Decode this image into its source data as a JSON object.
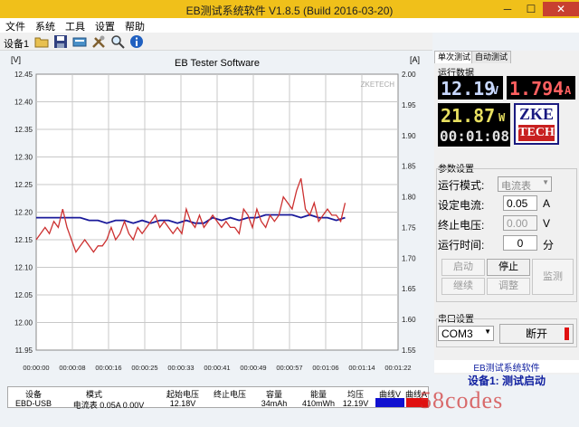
{
  "window": {
    "title": "EB测试系统软件 V1.8.5 (Build 2016-03-20)"
  },
  "menu": [
    "文件",
    "系统",
    "工具",
    "设置",
    "帮助"
  ],
  "toolbar": {
    "device_label": "设备1"
  },
  "chart_data": {
    "type": "line",
    "title": "EB Tester Software",
    "watermark": "ZKETECH",
    "y_left_label": "[V]",
    "y_right_label": "[A]",
    "ylim_left": [
      11.95,
      12.45
    ],
    "ylim_right": [
      1.55,
      2.0
    ],
    "yticks_left": [
      "12.45",
      "12.40",
      "12.35",
      "12.30",
      "12.25",
      "12.20",
      "12.15",
      "12.10",
      "12.05",
      "12.00",
      "11.95"
    ],
    "yticks_right": [
      "2.00",
      "1.95",
      "1.90",
      "1.85",
      "1.80",
      "1.75",
      "1.70",
      "1.65",
      "1.60",
      "1.55"
    ],
    "xticks": [
      "00:00:00",
      "00:00:08",
      "00:00:16",
      "00:00:25",
      "00:00:33",
      "00:00:41",
      "00:00:49",
      "00:00:57",
      "00:01:06",
      "00:01:14",
      "00:01:22"
    ],
    "series": [
      {
        "axis": "left",
        "color": "#1a1a9a",
        "x": [
          0,
          2,
          4,
          6,
          8,
          10,
          12,
          14,
          16,
          18,
          20,
          22,
          24,
          26,
          28,
          30,
          32,
          34,
          36,
          38,
          40,
          42,
          44,
          46,
          48,
          50,
          52,
          54,
          56,
          58,
          60,
          62,
          64,
          66,
          68,
          70
        ],
        "values": [
          12.19,
          12.19,
          12.19,
          12.19,
          12.19,
          12.19,
          12.185,
          12.185,
          12.18,
          12.185,
          12.185,
          12.18,
          12.185,
          12.18,
          12.185,
          12.185,
          12.18,
          12.185,
          12.18,
          12.18,
          12.19,
          12.185,
          12.19,
          12.185,
          12.19,
          12.19,
          12.195,
          12.195,
          12.195,
          12.195,
          12.19,
          12.195,
          12.19,
          12.19,
          12.185,
          12.19
        ]
      },
      {
        "axis": "right",
        "color": "#cc3030",
        "x": [
          0,
          1,
          2,
          3,
          4,
          5,
          6,
          7,
          8,
          9,
          10,
          11,
          12,
          13,
          14,
          15,
          16,
          17,
          18,
          19,
          20,
          21,
          22,
          23,
          24,
          25,
          26,
          27,
          28,
          29,
          30,
          31,
          32,
          33,
          34,
          35,
          36,
          37,
          38,
          39,
          40,
          41,
          42,
          43,
          44,
          45,
          46,
          47,
          48,
          49,
          50,
          51,
          52,
          53,
          54,
          55,
          56,
          57,
          58,
          59,
          60,
          61,
          62,
          63,
          64,
          65,
          66,
          67,
          68,
          69,
          70
        ],
        "values": [
          1.73,
          1.74,
          1.75,
          1.74,
          1.76,
          1.75,
          1.78,
          1.75,
          1.73,
          1.71,
          1.72,
          1.73,
          1.72,
          1.71,
          1.72,
          1.72,
          1.73,
          1.75,
          1.73,
          1.74,
          1.76,
          1.74,
          1.73,
          1.75,
          1.74,
          1.75,
          1.76,
          1.77,
          1.75,
          1.76,
          1.75,
          1.74,
          1.75,
          1.74,
          1.78,
          1.76,
          1.75,
          1.77,
          1.75,
          1.76,
          1.77,
          1.76,
          1.75,
          1.76,
          1.75,
          1.75,
          1.74,
          1.78,
          1.77,
          1.75,
          1.78,
          1.76,
          1.75,
          1.77,
          1.76,
          1.77,
          1.8,
          1.79,
          1.78,
          1.81,
          1.83,
          1.78,
          1.77,
          1.79,
          1.76,
          1.77,
          1.78,
          1.77,
          1.77,
          1.76,
          1.79
        ]
      }
    ]
  },
  "right_panel": {
    "tabs": [
      "单次测试",
      "自动测试"
    ],
    "run_data_label": "运行数据",
    "voltage": "12.19",
    "voltage_unit": "V",
    "current": "1.794",
    "current_unit": "A",
    "power": "21.87",
    "power_unit": "W",
    "time": "00:01:08",
    "logo_top": "ZKE",
    "logo_bottom": "TECH",
    "params_label": "参数设置",
    "mode_label": "运行模式:",
    "mode_value": "电流表",
    "set_current_label": "设定电流:",
    "set_current_value": "0.05",
    "set_current_unit": "A",
    "stop_voltage_label": "终止电压:",
    "stop_voltage_value": "0.00",
    "stop_voltage_unit": "V",
    "run_time_label": "运行时间:",
    "run_time_value": "0",
    "run_time_unit": "分",
    "buttons": {
      "start": "启动",
      "stop": "停止",
      "monitor": "监测",
      "continue": "继续",
      "adjust": "调整"
    },
    "serial_label": "串口设置",
    "com_port": "COM3",
    "disconnect": "断开"
  },
  "status": {
    "header": "EB测试系统软件",
    "message": "设备1: 测试启动"
  },
  "table": {
    "headers": [
      "设备",
      "模式",
      "起始电压",
      "终止电压",
      "容量",
      "能量",
      "均压",
      "曲线V",
      "曲线A"
    ],
    "row": {
      "device": "EBD-USB",
      "mode": "电流表 0.05A 0.00V",
      "start_v": "12.18V",
      "end_v": "",
      "capacity": "34mAh",
      "energy": "410mWh",
      "avg_v": "12.19V"
    },
    "curve_v_color": "#1010d0",
    "curve_a_color": "#e01010"
  },
  "watermark": "58codes"
}
